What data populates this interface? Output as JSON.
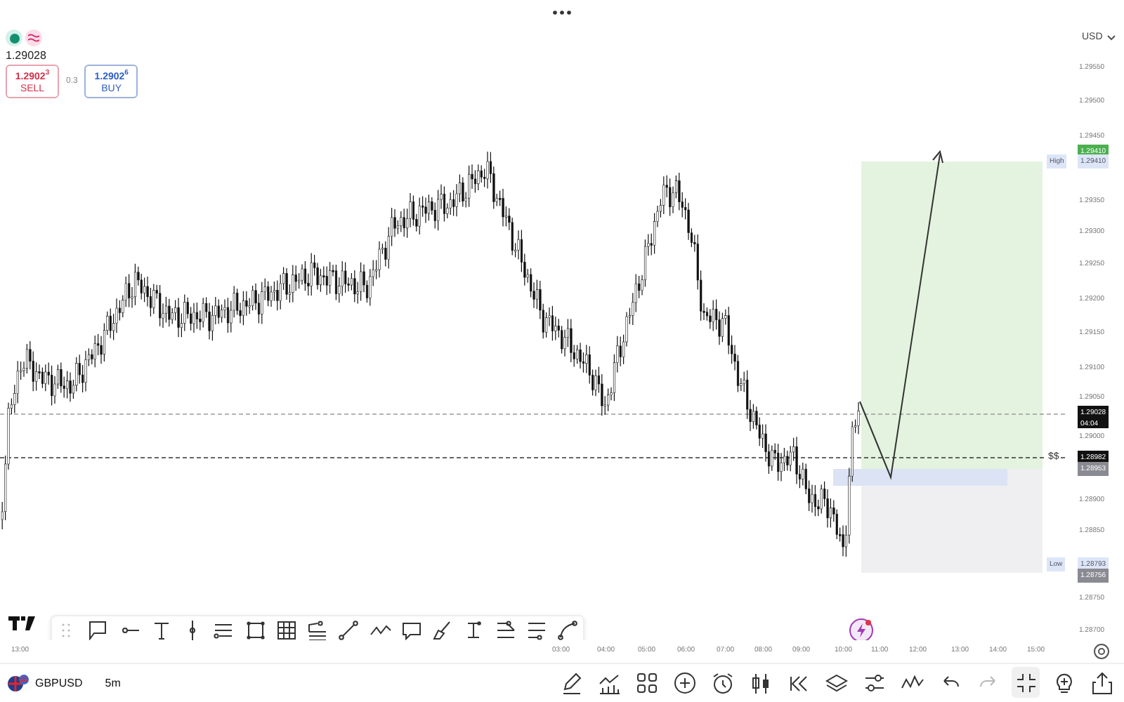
{
  "legend": {
    "price": "1.29028",
    "sell": {
      "price": "1.2902$^{3}$",
      "label": "SELL"
    },
    "spread": "0.3",
    "buy": {
      "price": "1.2902$^{6}$",
      "label": "BUY"
    }
  },
  "currency": "USD",
  "price_axis": {
    "ticks": [
      "1.29550",
      "1.29500",
      "1.29450",
      "1.29350",
      "1.29300",
      "1.29250",
      "1.29200",
      "1.29150",
      "1.29100",
      "1.29050",
      "1.29000",
      "1.28900",
      "1.28850",
      "1.28750",
      "1.28700"
    ],
    "markers": [
      {
        "kind": "target",
        "text": "1.29410"
      },
      {
        "kind": "high",
        "label": "High",
        "text": "1.29410"
      },
      {
        "kind": "last",
        "text": "1.29028",
        "sub": "04:04"
      },
      {
        "kind": "entry",
        "text": "1.28982",
        "tag": "$$"
      },
      {
        "kind": "stop",
        "text": "1.28953"
      },
      {
        "kind": "low",
        "label": "Low",
        "text": "1.28793"
      },
      {
        "kind": "stop",
        "text": "1.28756"
      }
    ]
  },
  "time_axis": [
    "13:00",
    "03:00",
    "04:00",
    "05:00",
    "06:00",
    "07:00",
    "08:00",
    "09:00",
    "10:00",
    "11:00",
    "12:00",
    "13:00",
    "14:00",
    "15:00"
  ],
  "symbol": {
    "name": "GBPUSD",
    "interval": "5m"
  },
  "toolbar_buttons": [
    {
      "disabled": false,
      "selected": false
    },
    {
      "disabled": false,
      "selected": false
    },
    {
      "disabled": false,
      "selected": false
    },
    {
      "disabled": false,
      "selected": false
    },
    {
      "disabled": false,
      "selected": false
    },
    {
      "disabled": false,
      "selected": false
    },
    {
      "disabled": false,
      "selected": false
    },
    {
      "disabled": false,
      "selected": false
    },
    {
      "disabled": false,
      "selected": false
    },
    {
      "disabled": false,
      "selected": false
    },
    {
      "disabled": false,
      "selected": false
    },
    {
      "disabled": true,
      "selected": false
    },
    {
      "disabled": false,
      "selected": true
    },
    {
      "disabled": false,
      "selected": false
    },
    {
      "disabled": false,
      "selected": false
    }
  ]
}
